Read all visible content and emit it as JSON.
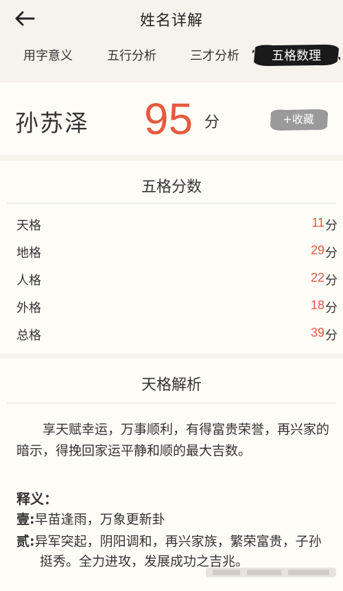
{
  "header": {
    "title": "姓名详解",
    "back_icon": "arrow-left-icon"
  },
  "tabs": [
    {
      "label": "用字意义",
      "active": false
    },
    {
      "label": "五行分析",
      "active": false
    },
    {
      "label": "三才分析",
      "active": false
    },
    {
      "label": "五格数理",
      "active": true
    }
  ],
  "score": {
    "name": "孙苏泽",
    "value": "95",
    "unit": "分",
    "favorite_label": "+收藏"
  },
  "wuge": {
    "title": "五格分数",
    "rows": [
      {
        "label": "天格",
        "value": "11",
        "unit": "分"
      },
      {
        "label": "地格",
        "value": "29",
        "unit": "分"
      },
      {
        "label": "人格",
        "value": "22",
        "unit": "分"
      },
      {
        "label": "外格",
        "value": "18",
        "unit": "分"
      },
      {
        "label": "总格",
        "value": "39",
        "unit": "分"
      }
    ]
  },
  "analysis": {
    "title": "天格解析",
    "paragraph": "享天赋幸运，万事顺利，有得富贵荣誉，再兴家的暗示，得挽回家运平静和顺的最大吉数。",
    "meaning_label": "释义：",
    "items": [
      {
        "prefix": "壹:",
        "text": "早苗逢雨，万象更新卦"
      },
      {
        "prefix": "贰:",
        "text": "异军突起，阴阳调和，再兴家族，繁荣富贵，子孙挺秀。全力进攻，发展成功之吉兆。"
      }
    ]
  },
  "colors": {
    "accent": "#e45a3f",
    "background": "#f6f3ec",
    "card": "#fffdf8",
    "active_tab": "#1a1a1a"
  }
}
